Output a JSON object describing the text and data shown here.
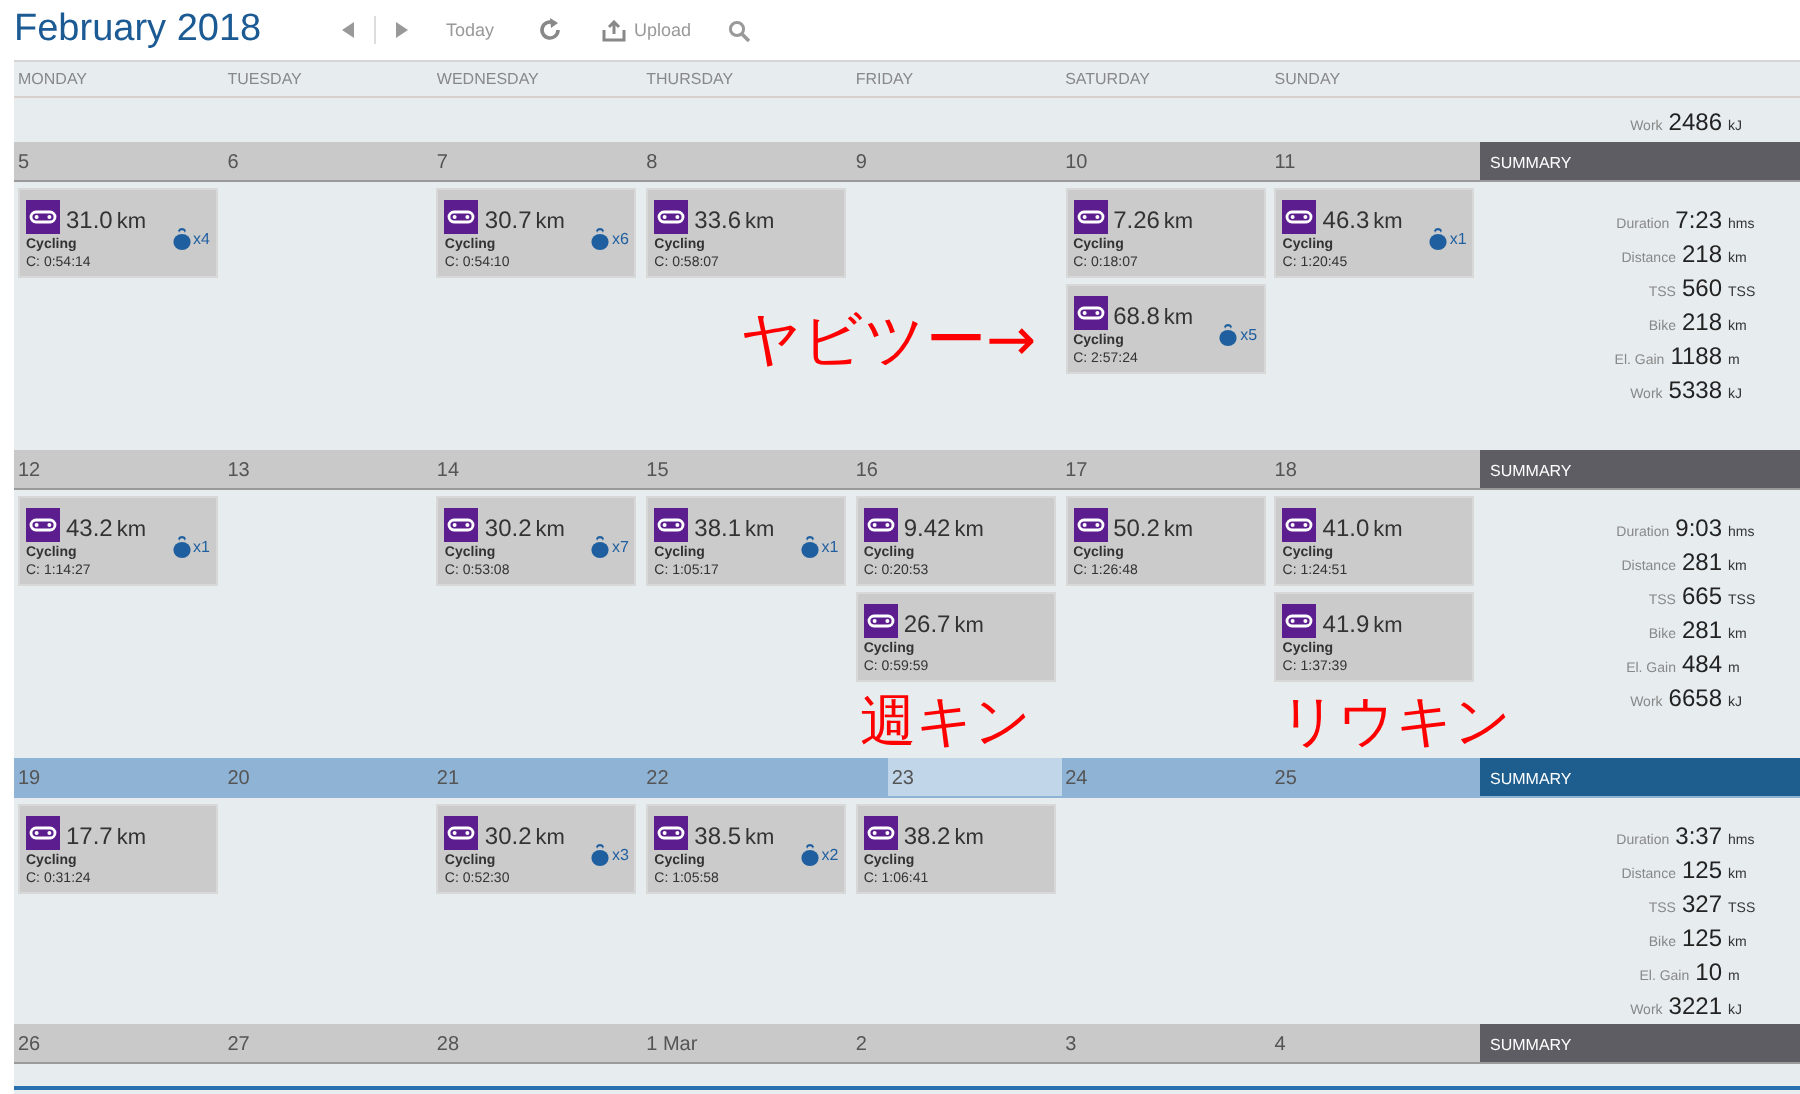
{
  "header": {
    "month": "February",
    "year": "2018",
    "today": "Today",
    "upload": "Upload"
  },
  "weekdays": [
    "MONDAY",
    "TUESDAY",
    "WEDNESDAY",
    "THURSDAY",
    "FRIDAY",
    "SATURDAY",
    "SUNDAY"
  ],
  "top_summary": {
    "label": "Work",
    "value": "2486",
    "unit": "kJ"
  },
  "weeks": [
    {
      "current": false,
      "days": [
        {
          "label": "5",
          "today": false,
          "workouts": [
            {
              "distance": "31.0",
              "unit": "km",
              "sport": "Cycling",
              "duration": "C: 0:54:14",
              "badge": "x4"
            }
          ]
        },
        {
          "label": "6",
          "today": false
        },
        {
          "label": "7",
          "today": false,
          "workouts": [
            {
              "distance": "30.7",
              "unit": "km",
              "sport": "Cycling",
              "duration": "C: 0:54:10",
              "badge": "x6"
            }
          ]
        },
        {
          "label": "8",
          "today": false,
          "workouts": [
            {
              "distance": "33.6",
              "unit": "km",
              "sport": "Cycling",
              "duration": "C: 0:58:07"
            }
          ]
        },
        {
          "label": "9",
          "today": false
        },
        {
          "label": "10",
          "today": false,
          "workouts": [
            {
              "distance": "7.26",
              "unit": "km",
              "sport": "Cycling",
              "duration": "C: 0:18:07"
            },
            {
              "distance": "68.8",
              "unit": "km",
              "sport": "Cycling",
              "duration": "C: 2:57:24",
              "badge": "x5"
            }
          ]
        },
        {
          "label": "11",
          "today": false,
          "workouts": [
            {
              "distance": "46.3",
              "unit": "km",
              "sport": "Cycling",
              "duration": "C: 1:20:45",
              "badge": "x1"
            }
          ]
        }
      ],
      "summary": {
        "title": "SUMMARY",
        "rows": [
          {
            "label": "Duration",
            "value": "7:23",
            "unit": "hms"
          },
          {
            "label": "Distance",
            "value": "218",
            "unit": "km"
          },
          {
            "label": "TSS",
            "value": "560",
            "unit": "TSS"
          },
          {
            "label": "Bike",
            "value": "218",
            "unit": "km"
          },
          {
            "label": "El. Gain",
            "value": "1188",
            "unit": "m"
          },
          {
            "label": "Work",
            "value": "5338",
            "unit": "kJ"
          }
        ]
      }
    },
    {
      "current": false,
      "days": [
        {
          "label": "12",
          "today": false,
          "workouts": [
            {
              "distance": "43.2",
              "unit": "km",
              "sport": "Cycling",
              "duration": "C: 1:14:27",
              "badge": "x1"
            }
          ]
        },
        {
          "label": "13",
          "today": false
        },
        {
          "label": "14",
          "today": false,
          "workouts": [
            {
              "distance": "30.2",
              "unit": "km",
              "sport": "Cycling",
              "duration": "C: 0:53:08",
              "badge": "x7"
            }
          ]
        },
        {
          "label": "15",
          "today": false,
          "workouts": [
            {
              "distance": "38.1",
              "unit": "km",
              "sport": "Cycling",
              "duration": "C: 1:05:17",
              "badge": "x1"
            }
          ]
        },
        {
          "label": "16",
          "today": false,
          "workouts": [
            {
              "distance": "9.42",
              "unit": "km",
              "sport": "Cycling",
              "duration": "C: 0:20:53"
            },
            {
              "distance": "26.7",
              "unit": "km",
              "sport": "Cycling",
              "duration": "C: 0:59:59"
            }
          ]
        },
        {
          "label": "17",
          "today": false,
          "workouts": [
            {
              "distance": "50.2",
              "unit": "km",
              "sport": "Cycling",
              "duration": "C: 1:26:48"
            }
          ]
        },
        {
          "label": "18",
          "today": false,
          "workouts": [
            {
              "distance": "41.0",
              "unit": "km",
              "sport": "Cycling",
              "duration": "C: 1:24:51"
            },
            {
              "distance": "41.9",
              "unit": "km",
              "sport": "Cycling",
              "duration": "C: 1:37:39"
            }
          ]
        }
      ],
      "summary": {
        "title": "SUMMARY",
        "rows": [
          {
            "label": "Duration",
            "value": "9:03",
            "unit": "hms"
          },
          {
            "label": "Distance",
            "value": "281",
            "unit": "km"
          },
          {
            "label": "TSS",
            "value": "665",
            "unit": "TSS"
          },
          {
            "label": "Bike",
            "value": "281",
            "unit": "km"
          },
          {
            "label": "El. Gain",
            "value": "484",
            "unit": "m"
          },
          {
            "label": "Work",
            "value": "6658",
            "unit": "kJ"
          }
        ]
      }
    },
    {
      "current": true,
      "days": [
        {
          "label": "19",
          "today": false,
          "workouts": [
            {
              "distance": "17.7",
              "unit": "km",
              "sport": "Cycling",
              "duration": "C: 0:31:24"
            }
          ]
        },
        {
          "label": "20",
          "today": false
        },
        {
          "label": "21",
          "today": false,
          "workouts": [
            {
              "distance": "30.2",
              "unit": "km",
              "sport": "Cycling",
              "duration": "C: 0:52:30",
              "badge": "x3"
            }
          ]
        },
        {
          "label": "22",
          "today": false,
          "workouts": [
            {
              "distance": "38.5",
              "unit": "km",
              "sport": "Cycling",
              "duration": "C: 1:05:58",
              "badge": "x2"
            }
          ]
        },
        {
          "label": "23",
          "today": true,
          "workouts": [
            {
              "distance": "38.2",
              "unit": "km",
              "sport": "Cycling",
              "duration": "C: 1:06:41"
            }
          ]
        },
        {
          "label": "24",
          "today": false
        },
        {
          "label": "25",
          "today": false
        }
      ],
      "summary": {
        "title": "SUMMARY",
        "rows": [
          {
            "label": "Duration",
            "value": "3:37",
            "unit": "hms"
          },
          {
            "label": "Distance",
            "value": "125",
            "unit": "km"
          },
          {
            "label": "TSS",
            "value": "327",
            "unit": "TSS"
          },
          {
            "label": "Bike",
            "value": "125",
            "unit": "km"
          },
          {
            "label": "El. Gain",
            "value": "10",
            "unit": "m"
          },
          {
            "label": "Work",
            "value": "3221",
            "unit": "kJ"
          }
        ]
      }
    },
    {
      "current": false,
      "days": [
        {
          "label": "26",
          "today": false
        },
        {
          "label": "27",
          "today": false
        },
        {
          "label": "28",
          "today": false
        },
        {
          "label": "1 Mar",
          "today": false
        },
        {
          "label": "2",
          "today": false
        },
        {
          "label": "3",
          "today": false
        },
        {
          "label": "4",
          "today": false
        }
      ],
      "summary": {
        "title": "SUMMARY"
      }
    }
  ],
  "annotations": [
    "ヤビツー→",
    "週キン",
    "リウキン"
  ]
}
